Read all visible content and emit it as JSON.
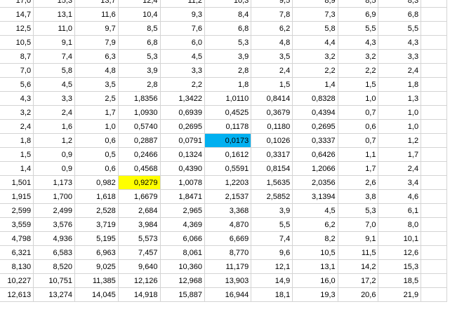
{
  "sheet": {
    "highlight_colors": {
      "yellow": "#ffff00",
      "blue": "#00b0f0"
    },
    "rows": [
      [
        {
          "v": "17,0"
        },
        {
          "v": "15,3"
        },
        {
          "v": "13,7"
        },
        {
          "v": "12,4"
        },
        {
          "v": "11,2"
        },
        {
          "v": "10,3"
        },
        {
          "v": "9,5"
        },
        {
          "v": "8,9"
        },
        {
          "v": "8,5"
        },
        {
          "v": "8,3"
        }
      ],
      [
        {
          "v": "14,7"
        },
        {
          "v": "13,1"
        },
        {
          "v": "11,6"
        },
        {
          "v": "10,4"
        },
        {
          "v": "9,3"
        },
        {
          "v": "8,4"
        },
        {
          "v": "7,8"
        },
        {
          "v": "7,3"
        },
        {
          "v": "6,9"
        },
        {
          "v": "6,8"
        }
      ],
      [
        {
          "v": "12,5"
        },
        {
          "v": "11,0"
        },
        {
          "v": "9,7"
        },
        {
          "v": "8,5"
        },
        {
          "v": "7,6"
        },
        {
          "v": "6,8"
        },
        {
          "v": "6,2"
        },
        {
          "v": "5,8"
        },
        {
          "v": "5,5"
        },
        {
          "v": "5,5"
        }
      ],
      [
        {
          "v": "10,5"
        },
        {
          "v": "9,1"
        },
        {
          "v": "7,9"
        },
        {
          "v": "6,8"
        },
        {
          "v": "6,0"
        },
        {
          "v": "5,3"
        },
        {
          "v": "4,8"
        },
        {
          "v": "4,4"
        },
        {
          "v": "4,3"
        },
        {
          "v": "4,3"
        }
      ],
      [
        {
          "v": "8,7"
        },
        {
          "v": "7,4"
        },
        {
          "v": "6,3"
        },
        {
          "v": "5,3"
        },
        {
          "v": "4,5"
        },
        {
          "v": "3,9"
        },
        {
          "v": "3,5"
        },
        {
          "v": "3,2"
        },
        {
          "v": "3,2"
        },
        {
          "v": "3,3"
        }
      ],
      [
        {
          "v": "7,0"
        },
        {
          "v": "5,8"
        },
        {
          "v": "4,8"
        },
        {
          "v": "3,9"
        },
        {
          "v": "3,3"
        },
        {
          "v": "2,8"
        },
        {
          "v": "2,4"
        },
        {
          "v": "2,2"
        },
        {
          "v": "2,2"
        },
        {
          "v": "2,4"
        }
      ],
      [
        {
          "v": "5,6"
        },
        {
          "v": "4,5"
        },
        {
          "v": "3,5"
        },
        {
          "v": "2,8"
        },
        {
          "v": "2,2"
        },
        {
          "v": "1,8"
        },
        {
          "v": "1,5"
        },
        {
          "v": "1,4"
        },
        {
          "v": "1,5"
        },
        {
          "v": "1,8"
        }
      ],
      [
        {
          "v": "4,3"
        },
        {
          "v": "3,3"
        },
        {
          "v": "2,5"
        },
        {
          "v": "1,8356"
        },
        {
          "v": "1,3422"
        },
        {
          "v": "1,0110"
        },
        {
          "v": "0,8414"
        },
        {
          "v": "0,8328"
        },
        {
          "v": "1,0"
        },
        {
          "v": "1,3"
        }
      ],
      [
        {
          "v": "3,2"
        },
        {
          "v": "2,4"
        },
        {
          "v": "1,7"
        },
        {
          "v": "1,0930"
        },
        {
          "v": "0,6939"
        },
        {
          "v": "0,4525"
        },
        {
          "v": "0,3679"
        },
        {
          "v": "0,4394"
        },
        {
          "v": "0,7"
        },
        {
          "v": "1,0"
        }
      ],
      [
        {
          "v": "2,4"
        },
        {
          "v": "1,6"
        },
        {
          "v": "1,0"
        },
        {
          "v": "0,5740"
        },
        {
          "v": "0,2695"
        },
        {
          "v": "0,1178"
        },
        {
          "v": "0,1180"
        },
        {
          "v": "0,2695"
        },
        {
          "v": "0,6"
        },
        {
          "v": "1,0"
        }
      ],
      [
        {
          "v": "1,8"
        },
        {
          "v": "1,2"
        },
        {
          "v": "0,6"
        },
        {
          "v": "0,2887"
        },
        {
          "v": "0,0791"
        },
        {
          "v": "0,0173",
          "hl": "blue"
        },
        {
          "v": "0,1026"
        },
        {
          "v": "0,3337"
        },
        {
          "v": "0,7"
        },
        {
          "v": "1,2"
        }
      ],
      [
        {
          "v": "1,5"
        },
        {
          "v": "0,9"
        },
        {
          "v": "0,5"
        },
        {
          "v": "0,2466"
        },
        {
          "v": "0,1324"
        },
        {
          "v": "0,1612"
        },
        {
          "v": "0,3317"
        },
        {
          "v": "0,6426"
        },
        {
          "v": "1,1"
        },
        {
          "v": "1,7"
        }
      ],
      [
        {
          "v": "1,4"
        },
        {
          "v": "0,9"
        },
        {
          "v": "0,6"
        },
        {
          "v": "0,4568"
        },
        {
          "v": "0,4390"
        },
        {
          "v": "0,5591"
        },
        {
          "v": "0,8154"
        },
        {
          "v": "1,2066"
        },
        {
          "v": "1,7"
        },
        {
          "v": "2,4"
        }
      ],
      [
        {
          "v": "1,501"
        },
        {
          "v": "1,173"
        },
        {
          "v": "0,982"
        },
        {
          "v": "0,9279",
          "hl": "yellow"
        },
        {
          "v": "1,0078"
        },
        {
          "v": "1,2203"
        },
        {
          "v": "1,5635"
        },
        {
          "v": "2,0356"
        },
        {
          "v": "2,6"
        },
        {
          "v": "3,4"
        }
      ],
      [
        {
          "v": "1,915"
        },
        {
          "v": "1,700"
        },
        {
          "v": "1,618"
        },
        {
          "v": "1,6679"
        },
        {
          "v": "1,8471"
        },
        {
          "v": "2,1537"
        },
        {
          "v": "2,5852"
        },
        {
          "v": "3,1394"
        },
        {
          "v": "3,8"
        },
        {
          "v": "4,6"
        }
      ],
      [
        {
          "v": "2,599"
        },
        {
          "v": "2,499"
        },
        {
          "v": "2,528"
        },
        {
          "v": "2,684"
        },
        {
          "v": "2,965"
        },
        {
          "v": "3,368"
        },
        {
          "v": "3,9"
        },
        {
          "v": "4,5"
        },
        {
          "v": "5,3"
        },
        {
          "v": "6,1"
        }
      ],
      [
        {
          "v": "3,559"
        },
        {
          "v": "3,576"
        },
        {
          "v": "3,719"
        },
        {
          "v": "3,984"
        },
        {
          "v": "4,369"
        },
        {
          "v": "4,870"
        },
        {
          "v": "5,5"
        },
        {
          "v": "6,2"
        },
        {
          "v": "7,0"
        },
        {
          "v": "8,0"
        }
      ],
      [
        {
          "v": "4,798"
        },
        {
          "v": "4,936"
        },
        {
          "v": "5,195"
        },
        {
          "v": "5,573"
        },
        {
          "v": "6,066"
        },
        {
          "v": "6,669"
        },
        {
          "v": "7,4"
        },
        {
          "v": "8,2"
        },
        {
          "v": "9,1"
        },
        {
          "v": "10,1"
        }
      ],
      [
        {
          "v": "6,321"
        },
        {
          "v": "6,583"
        },
        {
          "v": "6,963"
        },
        {
          "v": "7,457"
        },
        {
          "v": "8,061"
        },
        {
          "v": "8,770"
        },
        {
          "v": "9,6"
        },
        {
          "v": "10,5"
        },
        {
          "v": "11,5"
        },
        {
          "v": "12,6"
        }
      ],
      [
        {
          "v": "8,130"
        },
        {
          "v": "8,520"
        },
        {
          "v": "9,025"
        },
        {
          "v": "9,640"
        },
        {
          "v": "10,360"
        },
        {
          "v": "11,179"
        },
        {
          "v": "12,1"
        },
        {
          "v": "13,1"
        },
        {
          "v": "14,2"
        },
        {
          "v": "15,3"
        }
      ],
      [
        {
          "v": "10,227"
        },
        {
          "v": "10,751"
        },
        {
          "v": "11,385"
        },
        {
          "v": "12,126"
        },
        {
          "v": "12,968"
        },
        {
          "v": "13,903"
        },
        {
          "v": "14,9"
        },
        {
          "v": "16,0"
        },
        {
          "v": "17,2"
        },
        {
          "v": "18,5"
        }
      ],
      [
        {
          "v": "12,613"
        },
        {
          "v": "13,274"
        },
        {
          "v": "14,045"
        },
        {
          "v": "14,918"
        },
        {
          "v": "15,887"
        },
        {
          "v": "16,944"
        },
        {
          "v": "18,1"
        },
        {
          "v": "19,3"
        },
        {
          "v": "20,6"
        },
        {
          "v": "21,9"
        }
      ]
    ]
  }
}
